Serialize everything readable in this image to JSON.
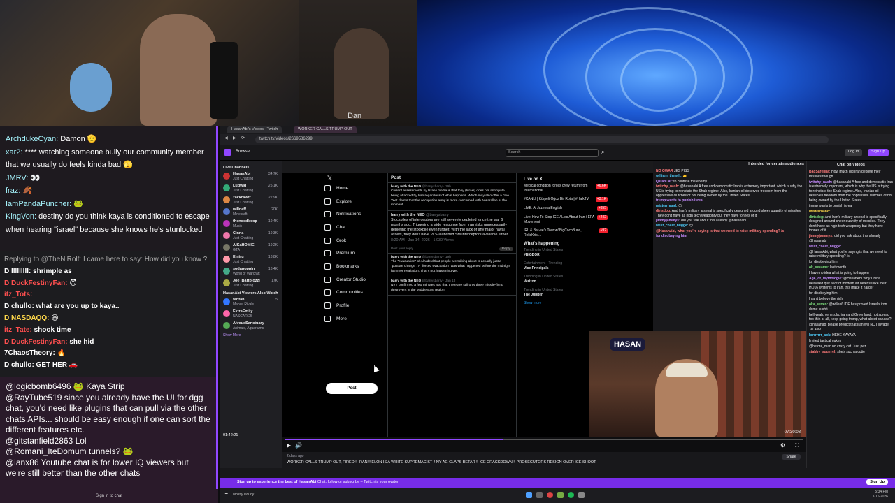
{
  "webcams": {
    "middle_label": "Dan"
  },
  "chat_left": {
    "messages": [
      {
        "user": "ArchdukeCyan:",
        "text": " Damon 🫡"
      },
      {
        "user": "xar2:",
        "text": " **** watching someone bully our community member that we usually do feels kinda bad 🫣"
      },
      {
        "user": "JMRV:",
        "text": " 👀"
      },
      {
        "user": "fraz:",
        "text": " 🍂"
      },
      {
        "user": "IamPandaPuncher:",
        "text": " 🐸"
      },
      {
        "user": "KingVon:",
        "text": " destiny do you think kaya is conditioned to escape when hearing \"israel\" because she knows he's stunlocked"
      }
    ],
    "nested": [
      {
        "user": "Replying to @TheNiRolf: I came here to say: How did you know ?",
        "text": "",
        "cls": "c-gray"
      },
      {
        "user": "D lllllllll:",
        "text": " shrimple as",
        "cls": "c-white"
      },
      {
        "user": "D DuckFestinyFan:",
        "text": " 😈",
        "cls": "c-red"
      },
      {
        "user": "itz_Tots:",
        "text": "",
        "cls": "c-red"
      },
      {
        "user": "D chullo:",
        "text": " what are you up to kaya..",
        "cls": "c-white"
      },
      {
        "user": "D NASDAQQ:",
        "text": " 😆",
        "cls": "c-yellow"
      },
      {
        "user": "itz_Tate:",
        "text": " shook time",
        "cls": "c-red"
      },
      {
        "user": "D DuckFestinyFan:",
        "text": " she hid",
        "cls": "c-red"
      },
      {
        "user": "7ChaosTheory:",
        "text": " 🔥",
        "cls": "c-white"
      },
      {
        "user": "D chullo:",
        "text": " GET HER 🚗",
        "cls": "c-white"
      }
    ]
  },
  "chat_left2": {
    "messages": [
      "@logicbomb6496 🐸 Kaya Strip",
      "@RayTube519 since you already have the UI for dgg chat, you'd need like plugins that can pull via the other chats APIs... should be easy enough if one can sort the different features etc.",
      "@gitstanfield2863 Lol",
      "@Romani_IteDomum tunnels? 🐸",
      "@ianx86 Youtube chat is for lower IQ viewers but we're still better than the other chats"
    ],
    "signin": "Sign in to chat"
  },
  "browser": {
    "tabs": [
      "HasanAbi's Videos - Twitch",
      "WORKER CALLS TRUMP OUT"
    ],
    "url": "twitch.tv/videos/2669586299",
    "nav_browse": "Browse",
    "search_placeholder": "Search",
    "login": "Log In",
    "signup": "Sign Up"
  },
  "sidebar": {
    "live_header": "Live Channels",
    "channels": [
      {
        "name": "HasanAbi",
        "game": "Just Chatting",
        "viewers": "34.7K",
        "color": "#c33"
      },
      {
        "name": "Ludwig",
        "game": "Just Chatting",
        "viewers": "25.1K",
        "color": "#3a7"
      },
      {
        "name": "zackrawrr",
        "game": "Just Chatting",
        "viewers": "22.9K",
        "color": "#d84"
      },
      {
        "name": "willneff",
        "game": "Minecraft",
        "viewers": "20K",
        "color": "#57c"
      },
      {
        "name": "thenoedlerop",
        "game": "Music",
        "viewers": "19.4K",
        "color": "#b3b"
      },
      {
        "name": "Cinna",
        "game": "Just Chatting",
        "viewers": "19.3K",
        "color": "#e7a"
      },
      {
        "name": "AlKaHOMIE",
        "game": "GTA",
        "viewers": "19.2K",
        "color": "#776"
      },
      {
        "name": "Emiru",
        "game": "Just Chatting",
        "viewers": "18.8K",
        "color": "#f9a"
      },
      {
        "name": "sodapoppin",
        "game": "World of Warcraft",
        "viewers": "18.4K",
        "color": "#4a8"
      },
      {
        "name": "Joe_Bartolozzi",
        "game": "Just Chatting",
        "viewers": "17K",
        "color": "#aa4"
      }
    ],
    "also_header": "HasanAbi Viewers Also Watch",
    "also": [
      {
        "name": "fanfan",
        "game": "Marvel Rivals",
        "viewers": "5",
        "color": "#37f"
      },
      {
        "name": "ExtraEmily",
        "game": "NASCAR 25",
        "viewers": "",
        "color": "#f6a"
      },
      {
        "name": "AlveusSanctuary",
        "game": "Animals, Aquariums",
        "viewers": "",
        "color": "#5a5"
      }
    ],
    "show_more": "Show More"
  },
  "x": {
    "nav": [
      "Home",
      "Explore",
      "Notifications",
      "Chat",
      "Grok",
      "Premium",
      "Bookmarks",
      "Creator Studio",
      "Communities",
      "Profile",
      "More"
    ],
    "post_button": "Post",
    "feed_header": "Post",
    "tweets": [
      {
        "author": "barry with the NEO",
        "handle": "@barrysbarry · 19h",
        "text": "Current assessments by Israeli media is that they (Israel) does not anticipate being attacked by Iran regardless of what happens. Which may also offer a clue. Yeet claims that the occupation army is more concerned with Ansarallah at the moment."
      },
      {
        "author": "barry with the NEO",
        "handle": "@barrysbarry",
        "text": "Stockpiles of interceptors are still severely depleted since the war 6 months ago. Triggering a wide response from Iran risks unnecessarily depleting the stockpile even further. With the lack of any major naval assets, they don't have VLS-launched SM interceptors available either.",
        "time": "8:20 AM · Jan 14, 2026 · 1,030 Views"
      },
      {
        "author": "barry with the NEO",
        "handle": "@barrysbarry · 19h",
        "text": "The \"evacuation\" of Al Udeid that people are talking about is actually just a \"posture change\". A \"forced evacuation\" was what happened before the midnight hammer retaliation. That's not happening yet."
      },
      {
        "author": "barry with the NEO",
        "handle": "@barrysbarry · Jan 13",
        "text": "NYT confirmed a few minutes ago that there are still only three missile-firing destroyers in the Middle East region"
      }
    ],
    "reply_placeholder": "Post your reply",
    "reply_button": "Reply",
    "live_on_x": "Live on X",
    "live_items": [
      {
        "title": "Medical condition forces crew return from International...",
        "count": "+6.6K"
      },
      {
        "title": "#CANLI | Körpeli Oğuz Bir Rota | #HalkTV",
        "count": "+3.1K"
      },
      {
        "title": "LIVE: Al Jazeera English",
        "count": "+355"
      },
      {
        "title": "Live: How To Stop ICE / Lies About Iran / EPA Movement",
        "count": "+242"
      },
      {
        "title": "IRL & Bar-ee's Tour w/ BigCocoBuns, RelicKris,...",
        "count": "+92"
      }
    ],
    "whats_happening": "What's happening",
    "trends": [
      {
        "sub": "Trending in United States",
        "title": "#BIGBOR"
      },
      {
        "sub": "Entertainment · Trending",
        "title": "Vice Principals"
      },
      {
        "sub": "Trending in United States",
        "title": "Verizon"
      },
      {
        "sub": "Trending in United States",
        "title": "The Jupiter"
      }
    ],
    "show_more": "Show more"
  },
  "nested_chat": {
    "header": "Intended for certain audiences",
    "messages": [
      {
        "user": "NO GWAR",
        "text": " JES PISS",
        "cls": "n-u"
      },
      {
        "user": "william_thewill:",
        "text": " 👍",
        "cls": "n-u3"
      },
      {
        "user": "QatanCat:",
        "text": " to confuse the enemy",
        "cls": "n-u2"
      },
      {
        "user": "twitchy_nash:",
        "text": " @hasanabi A free and democratic Iran is extremely important, which is why the US is trying to reinstate the Shah regime. Also, Iranian oil deserves freedom from the oppressive clutches of not being owned by the United States.",
        "cls": "n-u"
      },
      {
        "user": "trump wants to punish isreal",
        "text": "",
        "cls": "n-u2"
      },
      {
        "user": "misterrhand:",
        "text": " 😶",
        "cls": "n-u3"
      },
      {
        "user": "dirtsdog:",
        "text": " And Iran's military arsenal is specifically designed around sheer quantity of missiles. They don't have as high tech weaponry but they have tonnes of it",
        "cls": "n-u"
      },
      {
        "user": "jimmyjammys:",
        "text": " did you talk about this already @hasanabi",
        "cls": "n-u2"
      },
      {
        "user": "west_coast_hugge:",
        "text": " 😊",
        "cls": "n-u3"
      },
      {
        "user": "@HasanAbi, what you're saying is that we need to raise military spending? /s",
        "text": "",
        "cls": "n-u"
      },
      {
        "user": "for disobeying him",
        "text": "",
        "cls": "n-u2"
      }
    ]
  },
  "hasan_cam": {
    "logo": "HASAN",
    "time": "07:30:08"
  },
  "right_chat": {
    "header": "Chat on Videos",
    "messages": [
      {
        "user": "BadSarelina:",
        "text": " How much did Iran deplete their missiles though"
      },
      {
        "user": "twitchy_nash:",
        "text": " @hasanabi A free and democratic Iran is extremely important, which is why the US is trying to reinstate the Shah regime. Also, Iranian oil deserves freedom from the oppressive clutches of not being owned by the United States."
      },
      {
        "user": "",
        "text": "trump wants to punish isreal"
      },
      {
        "user": "misterrhand:",
        "text": ""
      },
      {
        "user": "dirtsdog:",
        "text": " And Iran's military arsenal is specifically designed around sheer quantity of missiles. They don't have as high tech weaponry but they have tonnes of it"
      },
      {
        "user": "jimmyjammys:",
        "text": " did you talk about this already @hasanabi"
      },
      {
        "user": "west_coast_hugge:",
        "text": ""
      },
      {
        "user": "",
        "text": "@HasanAbi, what you're saying is that we need to raise military spending? /s"
      },
      {
        "user": "",
        "text": "for disobeying him"
      },
      {
        "user": "ok_sesame:",
        "text": " last month"
      },
      {
        "user": "",
        "text": "I have no idea what is going to happen"
      },
      {
        "user": "Age_of_Mythologie:",
        "text": " @HasanAbi Why China delivered quit a lot of modern air defense like their HQ16 systems to Iran, this make it harder"
      },
      {
        "user": "",
        "text": "for disobeying him"
      },
      {
        "user": "",
        "text": "I can't believe the rich"
      },
      {
        "user": "oka_seven:",
        "text": " @willen6 IDF has proved Israel's iron dome is shit"
      },
      {
        "user": "",
        "text": "hell yeah, venezula, iran and Greenland, not spread too thin at all, keep going trump, what about canada?"
      },
      {
        "user": "",
        "text": "@hasanabi please predict that Iran will NOT invade Tel Aviv"
      },
      {
        "user": "brrrrrrrr_aok:",
        "text": " HEHE KAYAYA"
      },
      {
        "user": "",
        "text": "limited tactical nukes"
      },
      {
        "user": "",
        "text": "@before_man no crazy cat. Just pez"
      },
      {
        "user": "stabby_squirrel:",
        "text": " she's such a cutie"
      }
    ]
  },
  "player": {
    "time_left": "01:42:21",
    "progress": 0.42,
    "posted": "2 days ago",
    "title": "WORKER CALLS TRUMP OUT, FIRED ‼ IRAN ‼ ELON IS A WHITE SUPREMACIST ‼ NY AG CLAPS BETAR ‼ ICE CRACKDOWN ‼ PROSECUTORS RESIGN OVER ICE SHOOT",
    "share": "Share"
  },
  "banner": {
    "text": "Sign up to experience the best of HasanAbi",
    "sub": "Chat, follow or subscribe – Twitch is your oyster.",
    "button": "Sign Up"
  },
  "taskbar": {
    "weather": "Mostly cloudy",
    "time": "5:34 PM",
    "date": "1/16/2026"
  }
}
